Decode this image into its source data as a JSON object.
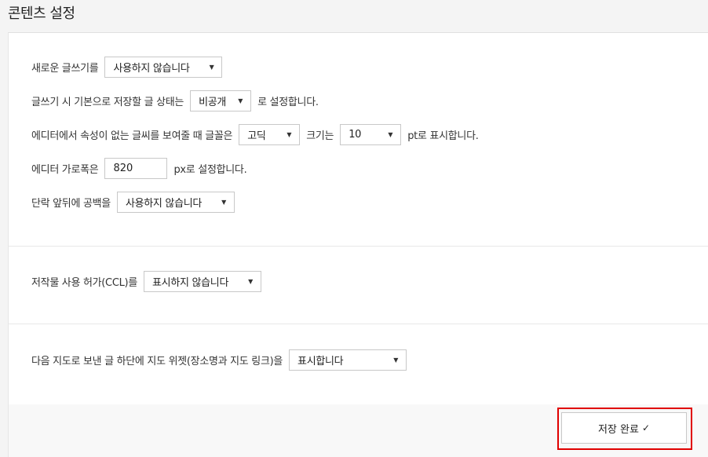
{
  "page": {
    "title": "콘텐츠 설정"
  },
  "settings": {
    "new_post": {
      "label": "새로운 글쓰기를",
      "value": "사용하지 않습니다"
    },
    "default_status": {
      "prefix": "글쓰기 시 기본으로 저장할 글 상태는",
      "value": "비공개",
      "suffix": "로 설정합니다."
    },
    "editor_font": {
      "prefix": "에디터에서 속성이 없는 글씨를 보여줄 때 글꼴은",
      "font_value": "고딕",
      "middle": "크기는",
      "size_value": "10",
      "suffix": "pt로 표시합니다."
    },
    "editor_width": {
      "prefix": "에디터 가로폭은",
      "value": "820",
      "suffix": "px로 설정합니다."
    },
    "paragraph_spacing": {
      "label": "단락 앞뒤에 공백을",
      "value": "사용하지 않습니다"
    },
    "ccl": {
      "label": "저작물 사용 허가(CCL)를",
      "value": "표시하지 않습니다"
    },
    "map_widget": {
      "label": "다음 지도로 보낸 글 하단에 지도 위젯(장소명과 지도 링크)을",
      "value": "표시합니다"
    }
  },
  "footer": {
    "save_label": "저장 완료",
    "check_icon": "✓"
  }
}
